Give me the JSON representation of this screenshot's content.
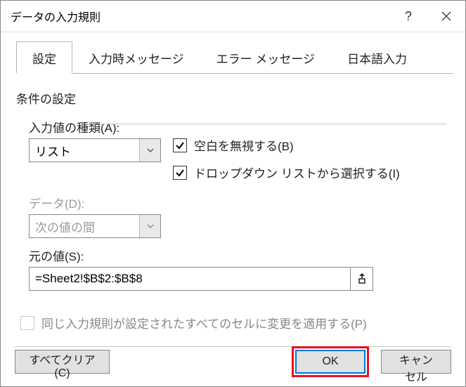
{
  "window": {
    "title": "データの入力規則"
  },
  "tabs": {
    "settings": "設定",
    "inputMsg": "入力時メッセージ",
    "errorMsg": "エラー メッセージ",
    "ime": "日本語入力"
  },
  "group": {
    "criteria": "条件の設定"
  },
  "allow": {
    "label": "入力値の種類(A):",
    "value": "リスト"
  },
  "dataOp": {
    "label": "データ(D):",
    "value": "次の値の間"
  },
  "checks": {
    "ignoreBlank": "空白を無視する(B)",
    "inCellDropdown": "ドロップダウン リストから選択する(I)"
  },
  "source": {
    "label": "元の値(S):",
    "value": "=Sheet2!$B$2:$B$8"
  },
  "applyAll": "同じ入力規則が設定されたすべてのセルに変更を適用する(P)",
  "buttons": {
    "clearAll": "すべてクリア(C)",
    "ok": "OK",
    "cancel": "キャンセル"
  }
}
